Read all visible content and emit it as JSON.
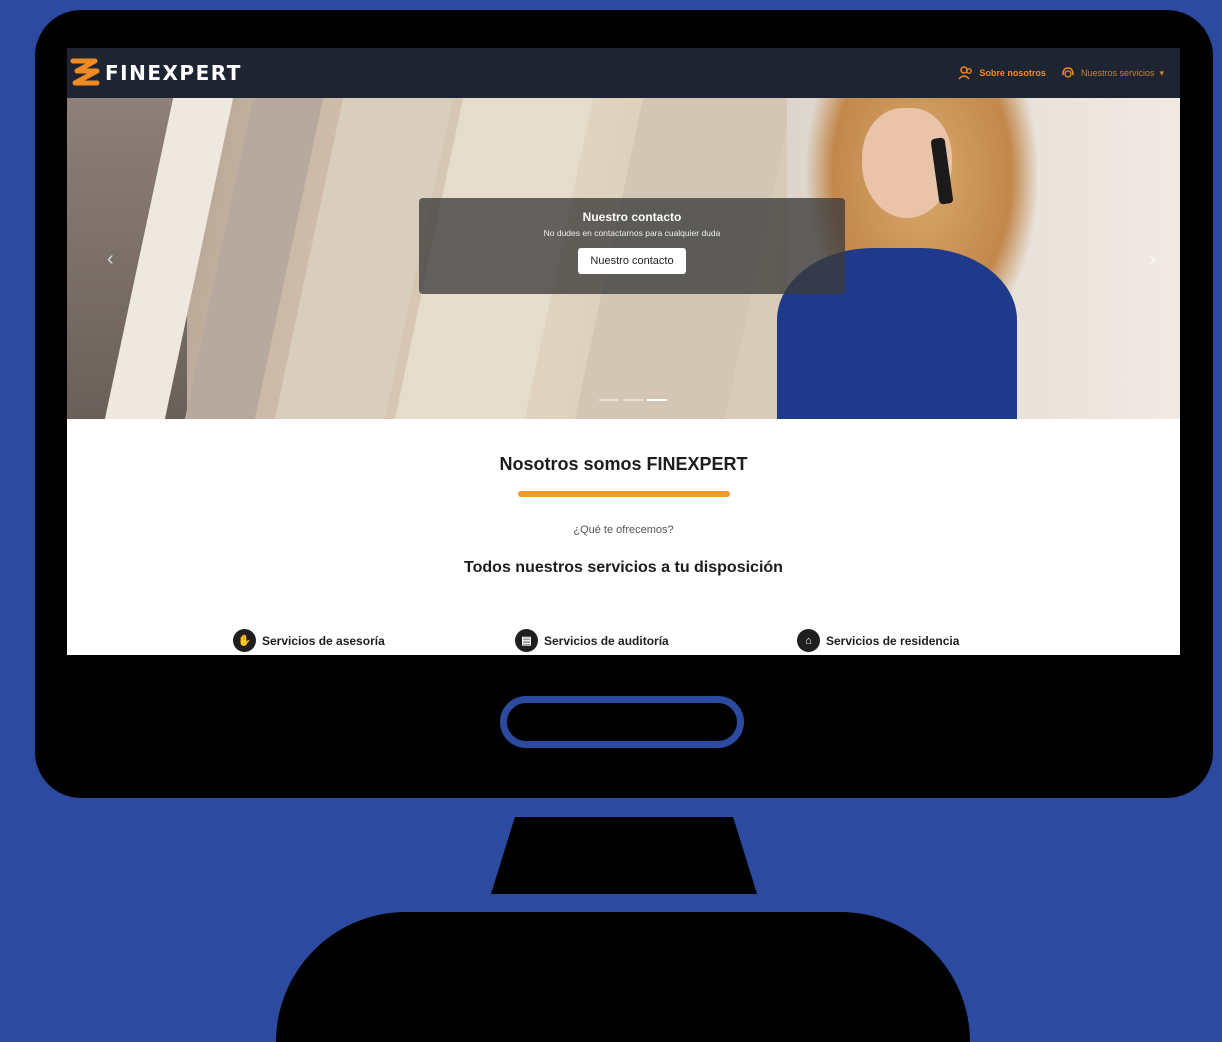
{
  "navbar": {
    "brand_name": "FINEXPERT",
    "links": [
      {
        "label": "Sobre nosotros",
        "icon": "users-icon"
      },
      {
        "label": "Nuestros servicios",
        "icon": "headset-icon"
      }
    ],
    "colors": {
      "background": "#1f2433",
      "accent": "#f08a24"
    }
  },
  "hero": {
    "caption_title": "Nuestro contacto",
    "caption_text": "No dudes en contactarnos para cualquier duda",
    "caption_button": "Nuestro contacto",
    "prev_arrow": "‹",
    "next_arrow": "›",
    "active_slide_index": 2,
    "slide_count": 3
  },
  "about": {
    "title": "Nosotros somos FINEXPERT",
    "subtitle": "¿Qué te ofrecemos?",
    "heading": "Todos nuestros servicios a tu disposición",
    "accent_color": "#f39a2e"
  },
  "services": [
    {
      "label": "Servicios de asesoría",
      "icon": "advisory-icon"
    },
    {
      "label": "Servicios de auditoría",
      "icon": "audit-icon"
    },
    {
      "label": "Servicios de residencia",
      "icon": "residence-icon"
    }
  ],
  "page": {
    "background": "#2b4aa0"
  }
}
